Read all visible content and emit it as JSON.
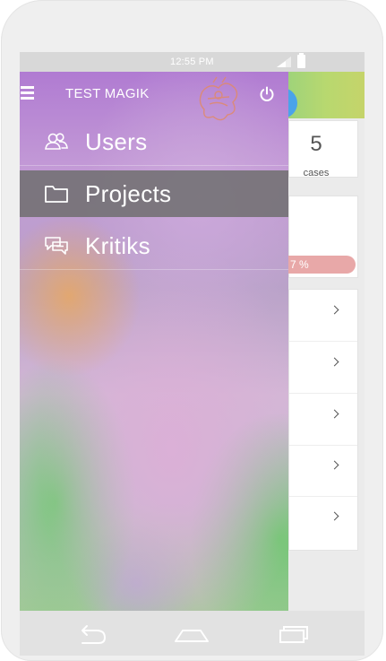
{
  "status_bar": {
    "time": "12:55 PM"
  },
  "drawer": {
    "title": "TEST MAGIK",
    "items": [
      {
        "label": "Users",
        "icon": "users-icon",
        "active": false
      },
      {
        "label": "Projects",
        "icon": "folder-icon",
        "active": true
      },
      {
        "label": "Kritiks",
        "icon": "chat-bubbles-icon",
        "active": false
      }
    ]
  },
  "background_app": {
    "stat_value": "5",
    "stat_label": "cases",
    "progress_text": "7 %",
    "list_rows": 5
  },
  "colors": {
    "drawer_active": "#6e6e6e",
    "fab_blue": "#4aa3ea",
    "progress_pill": "#e8a8a8",
    "header_green": "#b8d86f"
  }
}
